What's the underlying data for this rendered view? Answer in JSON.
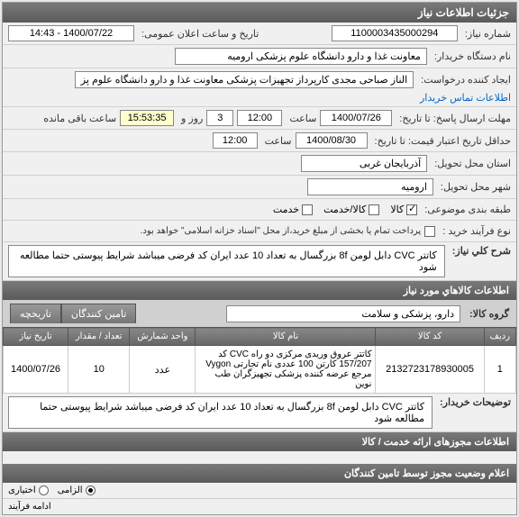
{
  "header": {
    "title": "جزئیات اطلاعات نیاز"
  },
  "form": {
    "req_no_label": "شماره نیاز:",
    "req_no": "1100003435000294",
    "public_date_label": "تاریخ و ساعت اعلان عمومی:",
    "public_date": "1400/07/22 - 14:43",
    "buyer_label": "نام دستگاه خریدار:",
    "buyer": "معاونت غذا و دارو دانشگاه علوم پزشکی ارومیه",
    "creator_label": "ایجاد کننده درخواست:",
    "creator": "الناز صباحی مجدی کارپرداز تجهیزات پزشکی معاونت غذا و دارو دانشگاه علوم پز",
    "contact_link": "اطلاعات تماس خریدار",
    "deadline_label": "مهلت ارسال پاسخ: تا تاریخ:",
    "deadline_date": "1400/07/26",
    "deadline_hour_label": "ساعت",
    "deadline_hour": "12:00",
    "days_label": "روز و",
    "days": "3",
    "remaining_label": "ساعت باقی مانده",
    "remaining": "15:53:35",
    "min_date_label": "حداقل تاریخ اعتبار قیمت: تا تاریخ:",
    "min_date": "1400/08/30",
    "min_hour_label": "ساعت",
    "min_hour": "12:00",
    "province_label": "استان محل تحویل:",
    "province": "آذربایجان غربی",
    "city_label": "شهر محل تحویل:",
    "city": "ارومیه",
    "pack_label": "طبقه بندی موضوعی:",
    "opt_kala": "کالا",
    "opt_service": "کالا/خدمت",
    "opt_khadamat": "خدمت",
    "process_label": "نوع فرآیند خرید :",
    "process_note": "پرداخت تمام یا بخشی از مبلغ خرید،از محل \"اسناد خزانه اسلامی\" خواهد بود.",
    "desc_label": "شرح کلي نیاز:",
    "desc": "کاتتر CVC دابل لومن 8f بزرگسال به تعداد 10 عدد   ایران کد فرضی میباشد شرایط پیوستی حتما مطالعه شود",
    "items_header": "اطلاعات کالاهاي مورد نیاز",
    "group_label": "گروه کالا:",
    "group": "دارو، پزشکی و سلامت",
    "tab_suppliers": "تامین کنندگان",
    "tab_history": "تاریخچه",
    "notes_label": "توضیحات خریدار:",
    "notes": "کاتتر CVC دابل لومن 8f بزرگسال به تعداد 10 عدد   ایران کد فرضی میباشد شرایط پیوستی حتما مطالعه شود",
    "auth_header": "اطلاعات مجوزهای ارائه خدمت / کالا",
    "status_header": "اعلام وضعیت مجوز توسط تامین کنندگان",
    "mandatory": "الزامی",
    "optional": "اختیاری",
    "continue": "ادامه فرآیند"
  },
  "table": {
    "headers": {
      "row": "رديف",
      "code": "کد کالا",
      "name": "نام کالا",
      "unit": "واحد شمارش",
      "qty": "تعداد / مقدار",
      "date": "تاریخ نیاز"
    },
    "rows": [
      {
        "row": "1",
        "code": "2132723178930005",
        "name": "کاتتر عروق وریدی مرکزی دو راه CVC کد 157/207 کارتن 100 عددی نام تجارتی Vygon مرجع عرضه کننده پزشکی تجهیزگران طب نوین",
        "unit": "عدد",
        "qty": "10",
        "date": "1400/07/26"
      }
    ]
  }
}
